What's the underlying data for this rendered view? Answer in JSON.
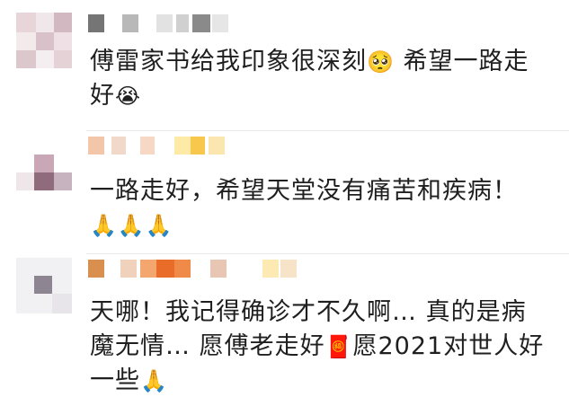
{
  "comments": [
    {
      "text": "傅雷家书给我印象很深刻",
      "emoji1": "🥺",
      "text2": " 希望一路走好",
      "emoji2": "😭"
    },
    {
      "text": "一路走好，希望天堂没有痛苦和疾病！",
      "emoji": "🙏🙏🙏"
    },
    {
      "text": "天哪！我记得确诊才不久啊… 真的是病魔无情… 愿傅老走好",
      "emoji": "🧧",
      "text2": "愿2021对世人好一些",
      "emoji2": "🙏"
    }
  ]
}
